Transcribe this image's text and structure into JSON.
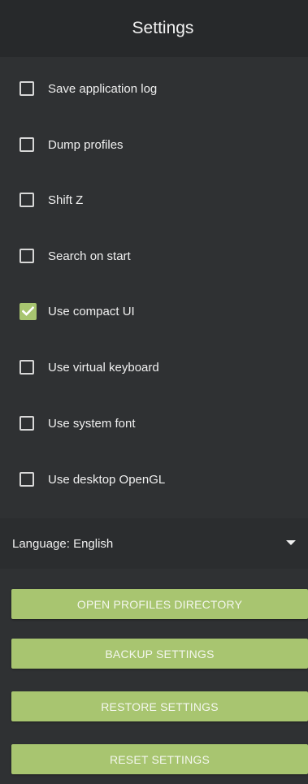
{
  "header": {
    "title": "Settings"
  },
  "options": [
    {
      "label": "Save application log",
      "checked": false
    },
    {
      "label": "Dump profiles",
      "checked": false
    },
    {
      "label": "Shift Z",
      "checked": false
    },
    {
      "label": "Search on start",
      "checked": false
    },
    {
      "label": "Use compact UI",
      "checked": true
    },
    {
      "label": "Use virtual keyboard",
      "checked": false
    },
    {
      "label": "Use system font",
      "checked": false
    },
    {
      "label": "Use desktop OpenGL",
      "checked": false
    }
  ],
  "language": {
    "label": "Language: English"
  },
  "buttons": {
    "open_profiles": "OPEN PROFILES DIRECTORY",
    "backup": "BACKUP SETTINGS",
    "restore": "RESTORE SETTINGS",
    "reset": "RESET SETTINGS"
  },
  "colors": {
    "accent": "#a8c570",
    "background": "#2f3133",
    "header": "#27292b"
  }
}
